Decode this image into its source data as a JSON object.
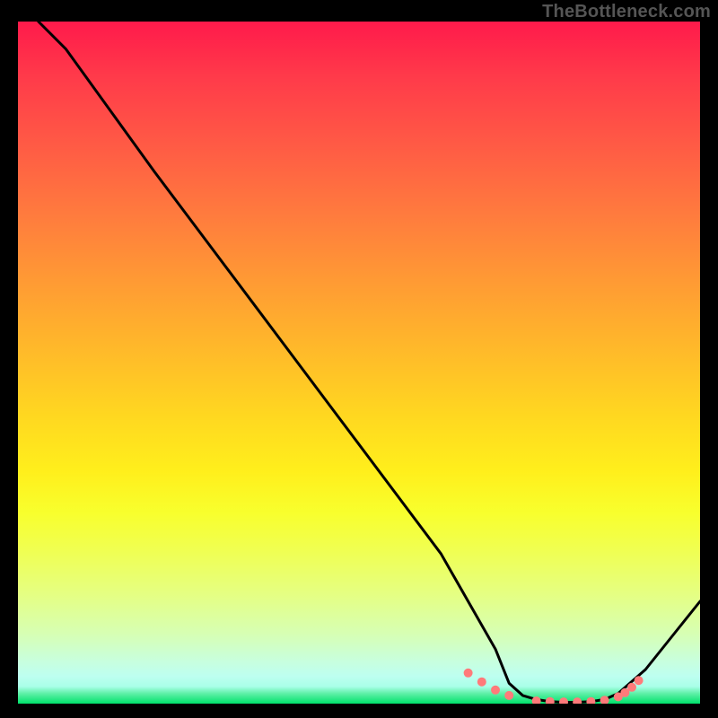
{
  "watermark": "TheBottleneck.com",
  "colors": {
    "background": "#000000",
    "curve": "#000000",
    "dots": "#ff7a7a",
    "gradient_top": "#ff1a4b",
    "gradient_bottom": "#00e26b"
  },
  "chart_data": {
    "type": "line",
    "title": "",
    "xlabel": "",
    "ylabel": "",
    "xlim": [
      0,
      100
    ],
    "ylim": [
      0,
      100
    ],
    "grid": false,
    "legend": false,
    "notes": "Normalized 0–100 axes estimated from gridless gradient plot. Curve shows a metric that drops from ~100 at x≈3 to ~0 at x≈72, stays near 0 through x≈88, then rises to ~15 at x=100. Dots mark highlighted points near the minimum.",
    "x": [
      3,
      7,
      20,
      35,
      50,
      62,
      70,
      72,
      74,
      76,
      78,
      80,
      82,
      84,
      86,
      88,
      92,
      96,
      100
    ],
    "values": [
      100,
      96,
      78,
      58,
      38,
      22,
      8,
      3,
      1.2,
      0.6,
      0.3,
      0.2,
      0.2,
      0.3,
      0.6,
      1.5,
      5,
      10,
      15
    ],
    "dots": {
      "x": [
        66,
        68,
        70,
        72,
        76,
        78,
        80,
        82,
        84,
        86,
        88,
        89,
        90,
        91
      ],
      "y": [
        4.5,
        3.2,
        2.0,
        1.2,
        0.4,
        0.3,
        0.25,
        0.25,
        0.3,
        0.5,
        1.0,
        1.6,
        2.4,
        3.4
      ]
    }
  }
}
